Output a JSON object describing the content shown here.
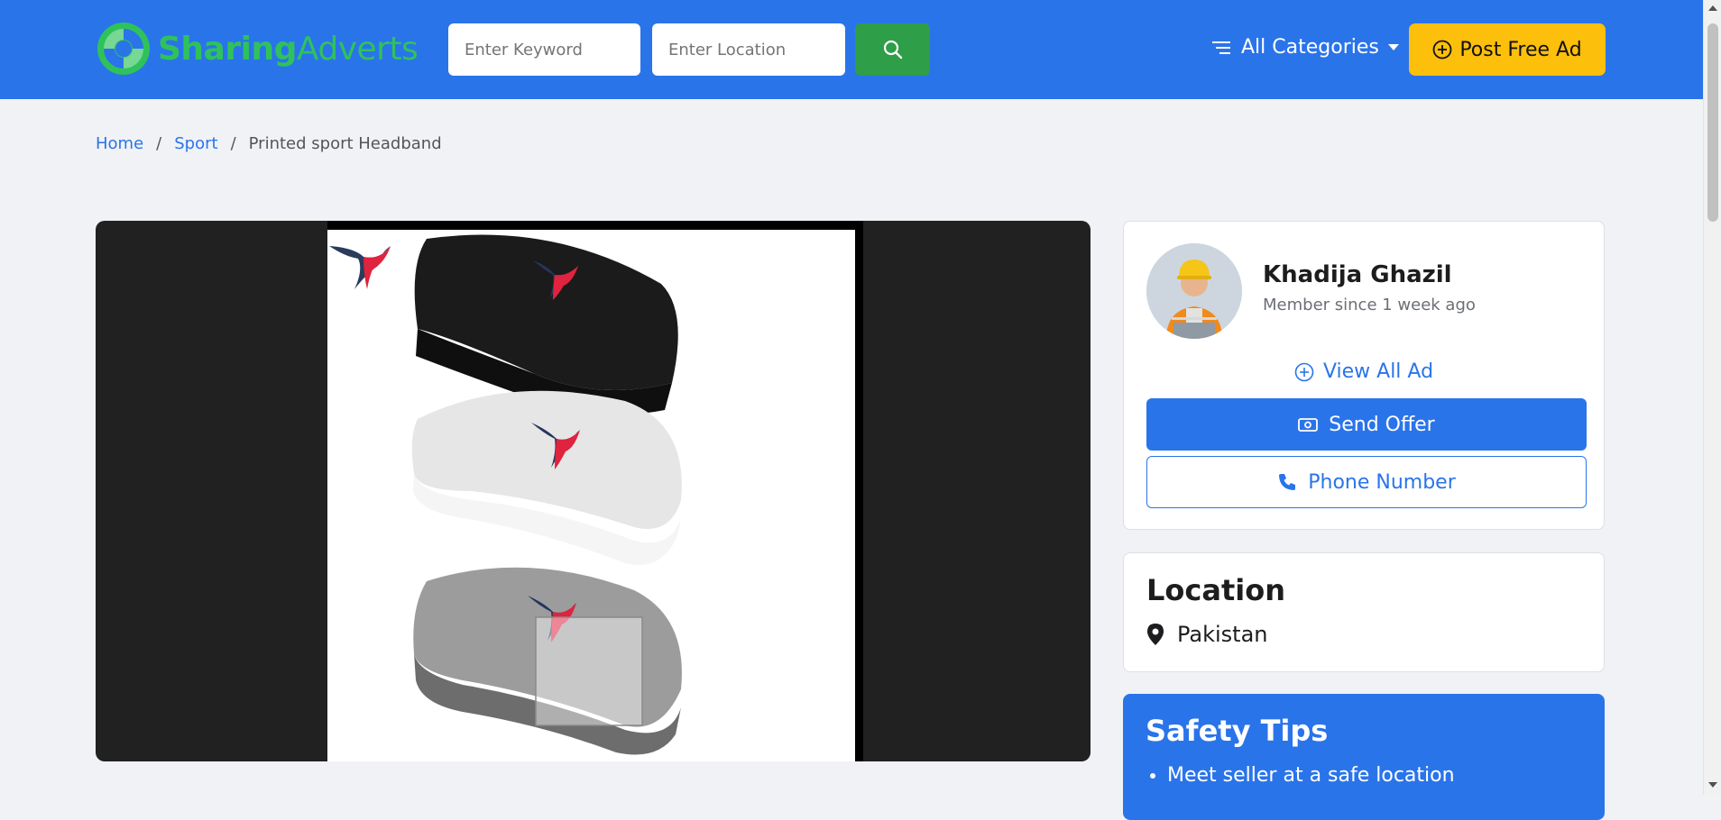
{
  "header": {
    "logo_primary": "Sharing",
    "logo_secondary": "Adverts",
    "keyword_placeholder": "Enter Keyword",
    "location_placeholder": "Enter Location",
    "categories_label": "All Categories",
    "post_ad_label": "Post Free Ad"
  },
  "breadcrumb": {
    "home": "Home",
    "category": "Sport",
    "current": "Printed sport Headband",
    "separator": "/"
  },
  "seller": {
    "name": "Khadija Ghazil",
    "member_since": "Member since 1 week ago",
    "view_all_label": "View All Ad",
    "send_offer_label": "Send Offer",
    "phone_label": "Phone Number"
  },
  "location": {
    "title": "Location",
    "value": "Pakistan"
  },
  "safety": {
    "title": "Safety Tips",
    "tips": [
      "Meet seller at a safe location"
    ]
  },
  "colors": {
    "brand_blue": "#2a74ea",
    "brand_green": "#2fc25b",
    "search_green": "#2e9e48",
    "post_yellow": "#fcbf0c"
  },
  "icons": {
    "logo": "logo-swirl-icon",
    "search": "search-icon",
    "categories": "menu-lines-icon",
    "post": "plus-circle-icon",
    "view_all": "plus-circle-icon",
    "offer": "cash-icon",
    "phone": "phone-icon",
    "location": "map-pin-icon"
  }
}
